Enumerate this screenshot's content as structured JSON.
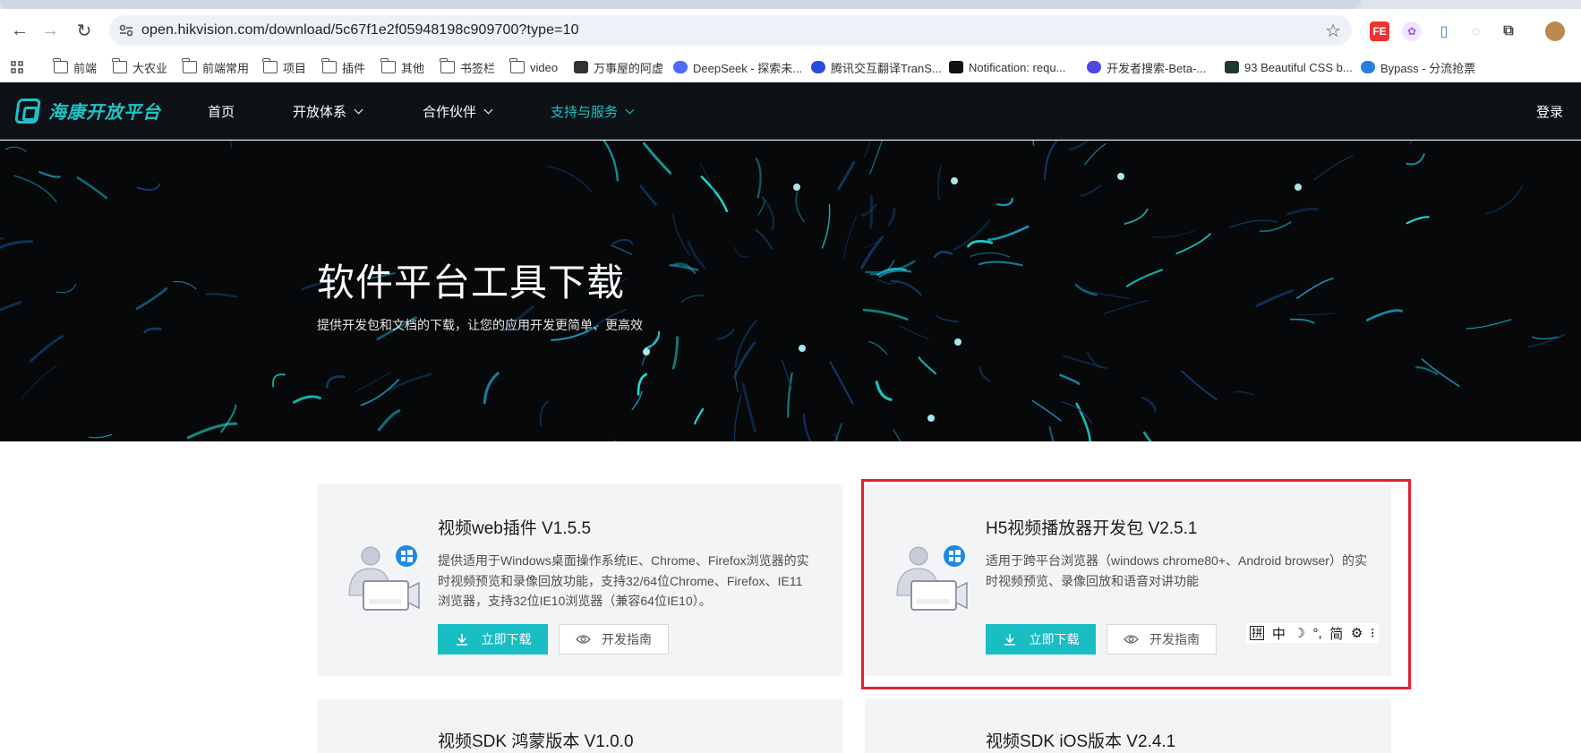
{
  "browser": {
    "url": "open.hikvision.com/download/5c67f1e2f05948198c909700?type=10",
    "bookmarks": [
      "前端",
      "大农业",
      "前端常用",
      "项目",
      "插件",
      "其他",
      "书签栏",
      "video",
      "万事屋的阿虚",
      "DeepSeek - 探索未...",
      "腾讯交互翻译TranS...",
      "Notification: requ...",
      "开发者搜索-Beta-...",
      "93 Beautiful CSS b...",
      "Bypass - 分流抢票"
    ]
  },
  "site": {
    "logo_text": "海康开放平台",
    "nav": {
      "home": "首页",
      "open_system": "开放体系",
      "partners": "合作伙伴",
      "support": "支持与服务",
      "login": "登录"
    },
    "accent_color": "#1ec3c7"
  },
  "hero": {
    "title": "软件平台工具下载",
    "subtitle": "提供开发包和文档的下载，让您的应用开发更简单、更高效"
  },
  "cards": [
    {
      "title": "视频web插件 V1.5.5",
      "description": "提供适用于Windows桌面操作系统IE、Chrome、Firefox浏览器的实时视频预览和录像回放功能，支持32/64位Chrome、Firefox、IE11浏览器，支持32位IE10浏览器（兼容64位IE10）。",
      "download_label": "立即下载",
      "guide_label": "开发指南"
    },
    {
      "title": "H5视频播放器开发包 V2.5.1",
      "description": "适用于跨平台浏览器（windows chrome80+、Android browser）的实时视频预览、录像回放和语音对讲功能",
      "download_label": "立即下载",
      "guide_label": "开发指南"
    }
  ],
  "cards_partial": [
    {
      "title": "视频SDK 鸿蒙版本 V1.0.0"
    },
    {
      "title": "视频SDK iOS版本 V2.4.1"
    }
  ],
  "ime": {
    "items": [
      "拼",
      "中",
      "☽",
      "°,",
      "简",
      "⚙",
      "⁝"
    ]
  }
}
